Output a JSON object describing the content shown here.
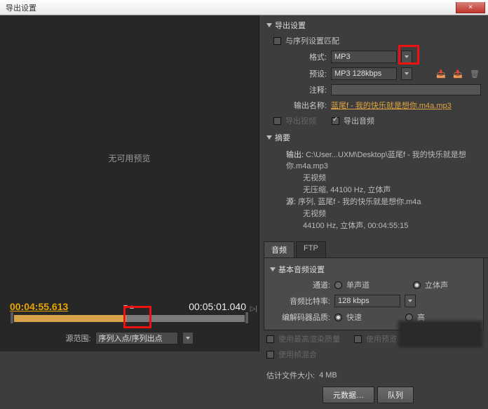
{
  "window": {
    "title": "导出设置",
    "close": "×"
  },
  "preview": {
    "no_preview": "无可用预览"
  },
  "timeline": {
    "in": "00:04:55.613",
    "out": "00:05:01.040"
  },
  "source": {
    "label": "源范围:",
    "value": "序列入点/序列出点"
  },
  "export": {
    "section": "导出设置",
    "match_seq": "与序列设置匹配",
    "format_label": "格式:",
    "format_value": "MP3",
    "preset_label": "预设:",
    "preset_value": "MP3 128kbps",
    "comment_label": "注释:",
    "outname_label": "输出名称:",
    "outname_value": "蓝尾f - 我的快乐就是想你.m4a.mp3",
    "export_video": "导出视频",
    "export_audio": "导出音频"
  },
  "summary": {
    "section": "摘要",
    "out_label": "输出:",
    "out_path": "C:\\User...UXM\\Desktop\\蓝尾f - 我的快乐就是想你.m4a.mp3",
    "out_l1": "无视频",
    "out_l2": "无压缩, 44100 Hz, 立体声",
    "src_label": "源:",
    "src_path": "序列, 蓝尾f - 我的快乐就是想你.m4a",
    "src_l1": "无视频",
    "src_l2": "44100 Hz, 立体声, 00:04:55:15"
  },
  "tabs": {
    "audio": "音频",
    "ftp": "FTP"
  },
  "audio": {
    "section": "基本音频设置",
    "channels_label": "通道:",
    "mono": "单声道",
    "stereo": "立体声",
    "bitrate_label": "音频比特率:",
    "bitrate_value": "128 kbps",
    "quality_label": "编解码器品质:",
    "fast": "快速",
    "high": "高"
  },
  "options": {
    "max_quality": "使用最高渲染质量",
    "use_preview": "使用预览",
    "frame_blend": "使用帧混合"
  },
  "estimate": {
    "label": "估计文件大小:",
    "value": "4 MB"
  },
  "buttons": {
    "metadata": "元数据…",
    "queue": "队列"
  },
  "chart_data": {
    "type": "table",
    "note": "no chart present"
  }
}
